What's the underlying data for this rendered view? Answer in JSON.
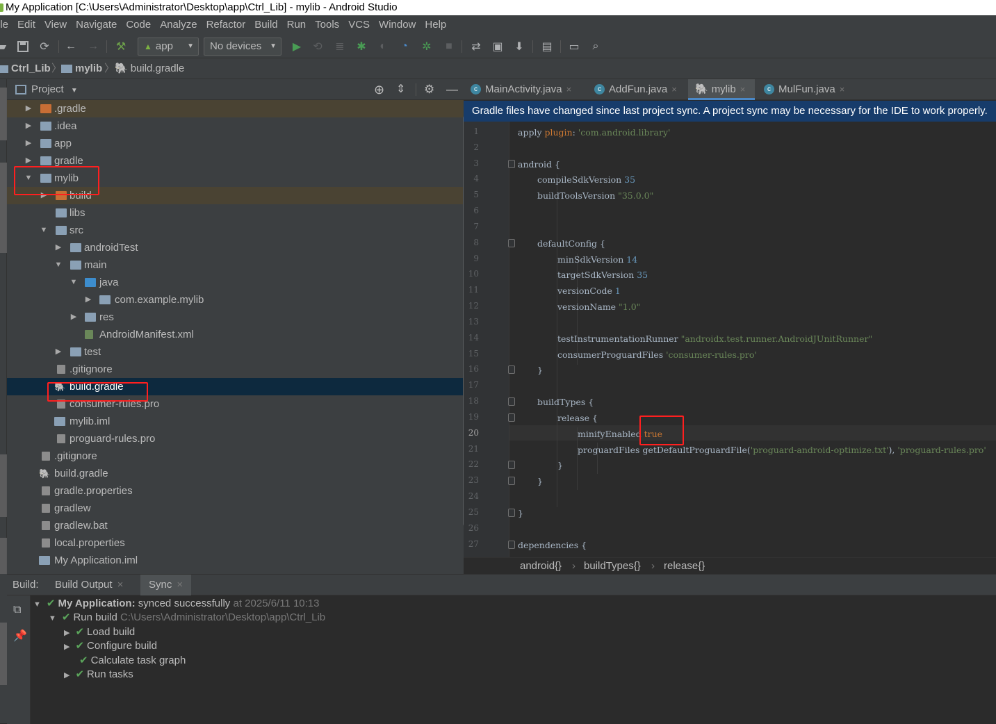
{
  "window": {
    "title": "My Application [C:\\Users\\Administrator\\Desktop\\app\\Ctrl_Lib] - mylib - Android Studio"
  },
  "menu": [
    "ile",
    "Edit",
    "View",
    "Navigate",
    "Code",
    "Analyze",
    "Refactor",
    "Build",
    "Run",
    "Tools",
    "VCS",
    "Window",
    "Help"
  ],
  "toolbar": {
    "run_config": "app",
    "device": "No devices"
  },
  "navbar": {
    "crumbs": [
      "Ctrl_Lib",
      "mylib",
      "build.gradle"
    ]
  },
  "project_panel": {
    "title": "Project",
    "tree": [
      {
        "label": ".gradle"
      },
      {
        "label": ".idea"
      },
      {
        "label": "app"
      },
      {
        "label": "gradle"
      },
      {
        "label": "mylib"
      },
      {
        "label": "build"
      },
      {
        "label": "libs"
      },
      {
        "label": "src"
      },
      {
        "label": "androidTest"
      },
      {
        "label": "main"
      },
      {
        "label": "java"
      },
      {
        "label": "com.example.mylib"
      },
      {
        "label": "res"
      },
      {
        "label": "AndroidManifest.xml"
      },
      {
        "label": "test"
      },
      {
        "label": ".gitignore"
      },
      {
        "label": "build.gradle"
      },
      {
        "label": "consumer-rules.pro"
      },
      {
        "label": "mylib.iml"
      },
      {
        "label": "proguard-rules.pro"
      },
      {
        "label": ".gitignore"
      },
      {
        "label": "build.gradle"
      },
      {
        "label": "gradle.properties"
      },
      {
        "label": "gradlew"
      },
      {
        "label": "gradlew.bat"
      },
      {
        "label": "local.properties"
      },
      {
        "label": "My Application.iml"
      }
    ]
  },
  "editor": {
    "tabs": [
      "MainActivity.java",
      "AddFun.java",
      "mylib",
      "MulFun.java"
    ],
    "banner": "Gradle files have changed since last project sync. A project sync may be necessary for the IDE to work properly.",
    "line_numbers": [
      "1",
      "2",
      "3",
      "4",
      "5",
      "6",
      "7",
      "8",
      "9",
      "10",
      "11",
      "12",
      "13",
      "14",
      "15",
      "16",
      "17",
      "18",
      "19",
      "20",
      "21",
      "22",
      "23",
      "24",
      "25",
      "26",
      "27"
    ],
    "code": {
      "l1_a": "apply ",
      "l1_b": "plugin",
      "l1_c": ": ",
      "l1_d": "'com.android.library'",
      "l3": "android {",
      "l4_a": "compileSdkVersion ",
      "l4_b": "35",
      "l5_a": "buildToolsVersion ",
      "l5_b": "\"35.0.0\"",
      "l8": "defaultConfig {",
      "l9_a": "minSdkVersion ",
      "l9_b": "14",
      "l10_a": "targetSdkVersion ",
      "l10_b": "35",
      "l11_a": "versionCode ",
      "l11_b": "1",
      "l12_a": "versionName ",
      "l12_b": "\"1.0\"",
      "l14_a": "testInstrumentationRunner ",
      "l14_b": "\"androidx.test.runner.AndroidJUnitRunner\"",
      "l15_a": "consumerProguardFiles ",
      "l15_b": "'consumer-rules.pro'",
      "l16": "}",
      "l18": "buildTypes {",
      "l19": "release {",
      "l20_a": "minifyEnabled ",
      "l20_b": "true",
      "l21_a": "proguardFiles getDefaultProguardFile(",
      "l21_b": "'proguard-android-optimize.txt'",
      "l21_c": "), ",
      "l21_d": "'proguard-rules.pro'",
      "l22": "}",
      "l23": "}",
      "l25": "}",
      "l27": "dependencies {"
    },
    "breadcrumb": [
      "android{}",
      "buildTypes{}",
      "release{}"
    ]
  },
  "build": {
    "label": "Build:",
    "tabs": [
      "Build Output",
      "Sync"
    ],
    "root_bold": "My Application:",
    "root_text": "synced successfully",
    "root_time": "at 2025/6/11 10:13",
    "run_build": "Run build",
    "run_build_path": "C:\\Users\\Administrator\\Desktop\\app\\Ctrl_Lib",
    "steps": [
      "Load build",
      "Configure build",
      "Calculate task graph",
      "Run tasks"
    ]
  },
  "colors": {
    "accent": "#4a88c7",
    "selection": "#0d293e",
    "highlight_box": "#ff1f1f",
    "success": "#5ba55b",
    "banner": "#173c6b"
  }
}
